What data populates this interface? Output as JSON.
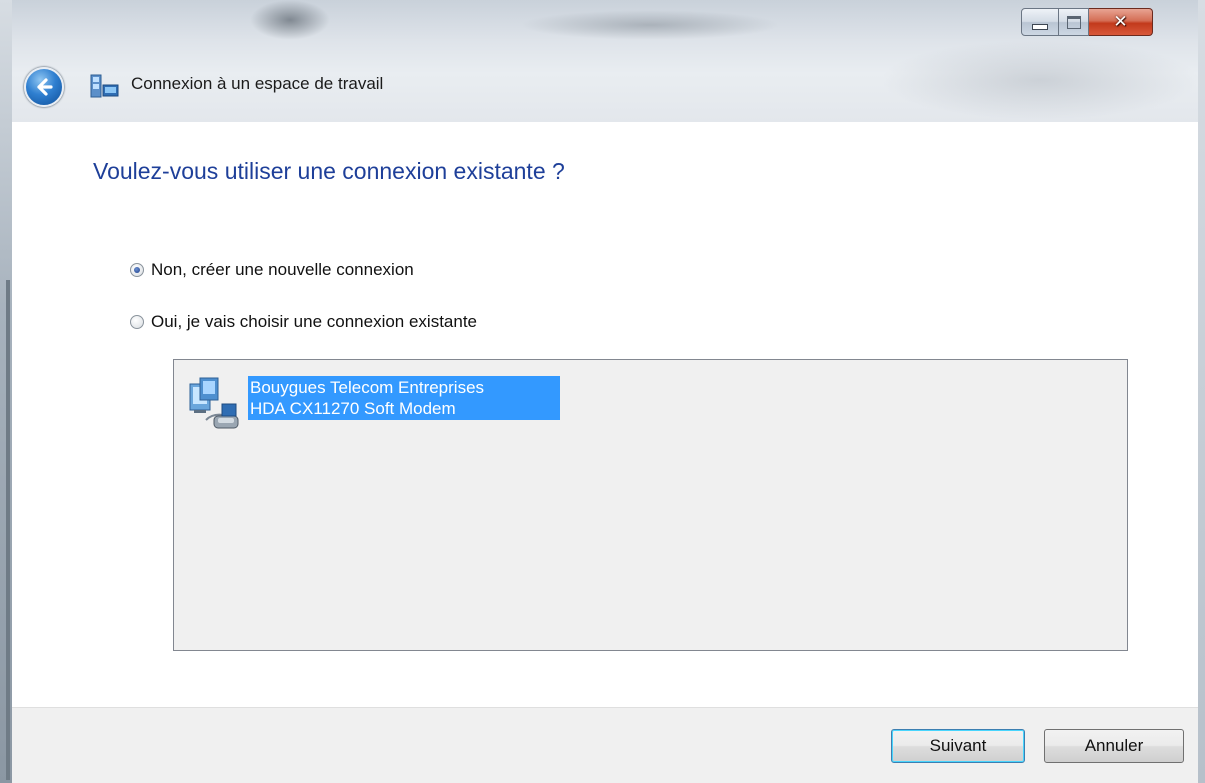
{
  "window": {
    "title": "Connexion à un espace de travail",
    "caption_buttons": {
      "minimize": "minimize-icon",
      "maximize": "maximize-icon",
      "close": "close-icon"
    }
  },
  "main": {
    "heading": "Voulez-vous utiliser une connexion existante ?",
    "options": [
      {
        "label": "Non, créer une nouvelle connexion",
        "checked": true
      },
      {
        "label": "Oui, je vais choisir une connexion existante",
        "checked": false
      }
    ],
    "connections": [
      {
        "name": "Bouygues Telecom Entreprises",
        "device": "HDA CX11270 Soft Modem",
        "icon": "dialup-network-icon",
        "selected": true
      }
    ]
  },
  "footer": {
    "next_label": "Suivant",
    "cancel_label": "Annuler"
  },
  "colors": {
    "heading": "#1e3f99",
    "selection": "#3399ff",
    "list_background": "#f0f0f0"
  }
}
